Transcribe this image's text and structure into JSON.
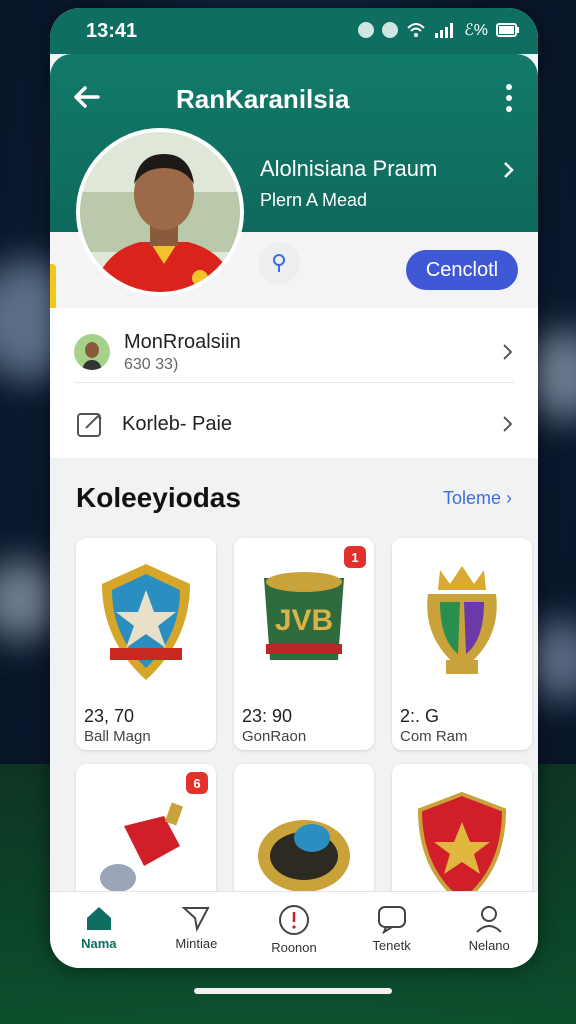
{
  "status": {
    "time": "13:41",
    "battery": "ℰ%"
  },
  "header": {
    "title": "RanKaranilsia"
  },
  "profile": {
    "name": "Alolnisiana Praum",
    "subtitle": "Plern A Mead"
  },
  "actions": {
    "cta_label": "Cenclotl"
  },
  "info_rows": [
    {
      "title": "MonRroalsiin",
      "subtitle": "630 33)"
    },
    {
      "title": "Korleb- Paie"
    }
  ],
  "collections": {
    "title": "Koleeyiodas",
    "see_all": "Toleme",
    "items": [
      {
        "value": "23, 70",
        "label": "Ball Magn",
        "badge": ""
      },
      {
        "value": "23: 90",
        "label": "GonRaon",
        "badge": "1"
      },
      {
        "value": "2:. G",
        "label": "Com Ram",
        "badge": ""
      },
      {
        "value": "",
        "label": "",
        "badge": "6"
      },
      {
        "value": "",
        "label": "",
        "badge": ""
      },
      {
        "value": "",
        "label": "",
        "badge": ""
      }
    ]
  },
  "nav": [
    {
      "label": "Nama",
      "icon": "home-icon"
    },
    {
      "label": "Mintiae",
      "icon": "send-icon"
    },
    {
      "label": "Roonon",
      "icon": "alert-icon"
    },
    {
      "label": "Tenetk",
      "icon": "chat-icon"
    },
    {
      "label": "Nelano",
      "icon": "person-icon"
    }
  ],
  "colors": {
    "primary": "#0d6e61",
    "accent": "#3f59d6",
    "badge": "#e2312d"
  }
}
